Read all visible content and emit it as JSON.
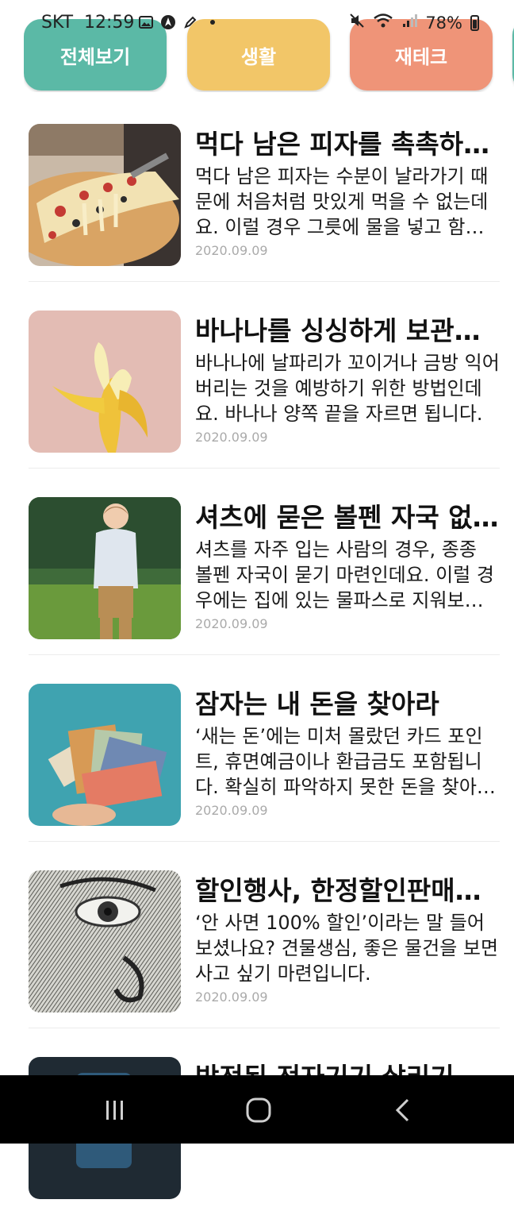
{
  "status_bar": {
    "carrier": "SKT",
    "time": "12:59",
    "battery": "78%",
    "icons": [
      "gallery-icon",
      "navigation-icon",
      "pen-icon",
      "dot-icon",
      "mute-icon",
      "wifi-icon",
      "signal-icon",
      "battery-icon"
    ]
  },
  "tabs": [
    {
      "label": "전체보기",
      "color": "#5bb9a6"
    },
    {
      "label": "생활",
      "color": "#f2c668"
    },
    {
      "label": "재테크",
      "color": "#ef9478"
    }
  ],
  "articles": [
    {
      "title": "먹다 남은 피자를 촉촉하게 데우는 방법",
      "summary": "먹다 남은 피자는 수분이 날라가기 때문에 처음처럼 맛있게 먹을 수 없는데요. 이럴 경우 그릇에 물을 넣고 함께 데워 보세요.",
      "date": "2020.09.09",
      "thumb": "pizza-image"
    },
    {
      "title": "바나나를 싱싱하게 보관하는 방법",
      "summary": "바나나에 날파리가 꼬이거나 금방 익어버리는 것을 예방하기 위한 방법인데요. 바나나 양쪽 끝을 자르면 됩니다.",
      "date": "2020.09.09",
      "thumb": "banana-image"
    },
    {
      "title": "셔츠에 묻은 볼펜 자국 없애는 방법",
      "summary": "셔츠를 자주 입는 사람의 경우, 종종 볼펜 자국이 묻기 마련인데요. 이럴 경우에는 집에 있는 물파스로 지워보세요.",
      "date": "2020.09.09",
      "thumb": "boy-image"
    },
    {
      "title": "잠자는 내 돈을 찾아라",
      "summary": "‘새는 돈’에는 미처 몰랐던 카드 포인트, 휴면예금이나 환급금도 포함됩니다. 확실히 파악하지 못한 돈을 찾아보세요.",
      "date": "2020.09.09",
      "thumb": "money-image"
    },
    {
      "title": "할인행사, 한정할인판매에 현혹되지 않기",
      "summary": "‘안 사면 100% 할인’이라는 말 들어보셨나요? 견물생심, 좋은 물건을 보면 사고 싶기 마련입니다.",
      "date": "2020.09.09",
      "thumb": "banknote-image"
    },
    {
      "title": "방전된 전자기기 살리기",
      "summary": "",
      "date": "",
      "thumb": "device-image"
    }
  ]
}
